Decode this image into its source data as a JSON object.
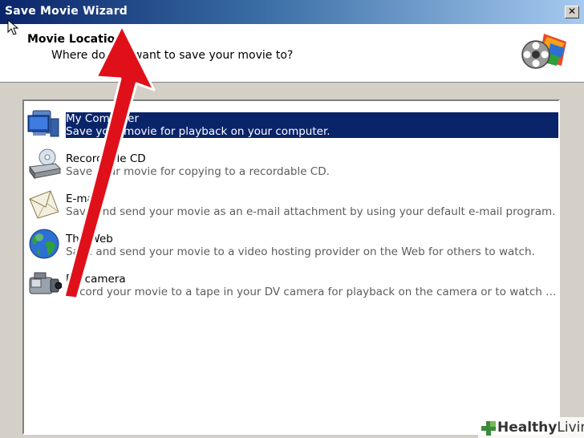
{
  "window": {
    "title": "Save Movie Wizard",
    "close_label": "✕"
  },
  "header": {
    "title": "Movie Location",
    "subtitle": "Where do you want to save your movie to?"
  },
  "options": [
    {
      "label": "My Computer",
      "description": "Save your movie for playback on your computer.",
      "icon": "computer-icon",
      "selected": true
    },
    {
      "label": "Recordable CD",
      "description": "Save your movie for copying to a recordable CD.",
      "icon": "cd-drive-icon",
      "selected": false
    },
    {
      "label": "E-mail",
      "description": "Save and send your movie as an e-mail attachment by using your default e-mail program.",
      "icon": "email-icon",
      "selected": false
    },
    {
      "label": "The Web",
      "description": "Save and send your movie to a video hosting provider on the Web for others to watch.",
      "icon": "globe-icon",
      "selected": false
    },
    {
      "label": "DV camera",
      "description": "Record your movie to a tape in your DV camera for playback on the camera or to watch on a television.",
      "icon": "camcorder-icon",
      "selected": false
    }
  ],
  "watermark": {
    "part1": "Healthy",
    "part2": "Living"
  },
  "colors": {
    "selection": "#0a246a",
    "arrow": "#e0101a",
    "watermark_plus": "#3c8a3c"
  }
}
